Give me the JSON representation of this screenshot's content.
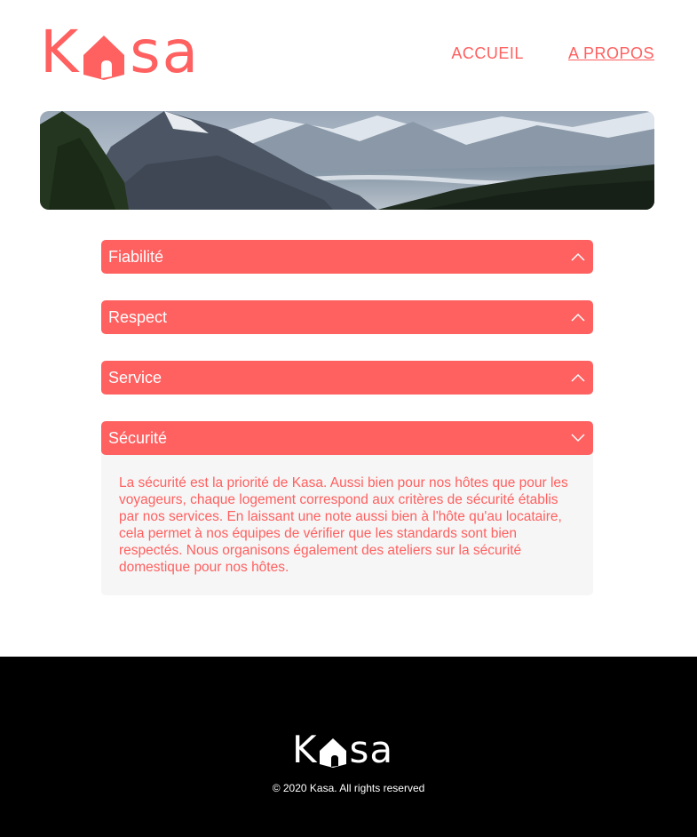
{
  "brand": {
    "logo_k": "K",
    "logo_sa": "sa",
    "color": "#ff6060"
  },
  "nav": {
    "home_label": "ACCUEIL",
    "about_label": "A PROPOS"
  },
  "banner": {
    "icon": "mountain-landscape-image"
  },
  "accordion": {
    "items": [
      {
        "title": "Fiabilité",
        "state": "collapsed",
        "icon": "chevron-up-icon"
      },
      {
        "title": "Respect",
        "state": "collapsed",
        "icon": "chevron-up-icon"
      },
      {
        "title": "Service",
        "state": "collapsed",
        "icon": "chevron-up-icon"
      },
      {
        "title": "Sécurité",
        "state": "expanded",
        "icon": "chevron-down-icon",
        "content": "La sécurité est la priorité de Kasa. Aussi bien pour nos hôtes que pour les voyageurs, chaque logement correspond aux critères de sécurité établis par nos services. En laissant une note aussi bien à l'hôte qu'au locataire, cela permet à nos équipes de vérifier que les standards sont bien respectés. Nous organisons également des ateliers sur la sécurité domestique pour nos hôtes."
      }
    ]
  },
  "footer": {
    "logo_k": "K",
    "logo_sa": "sa",
    "copyright": "© 2020 Kasa. All rights reserved",
    "background": "#000000"
  }
}
